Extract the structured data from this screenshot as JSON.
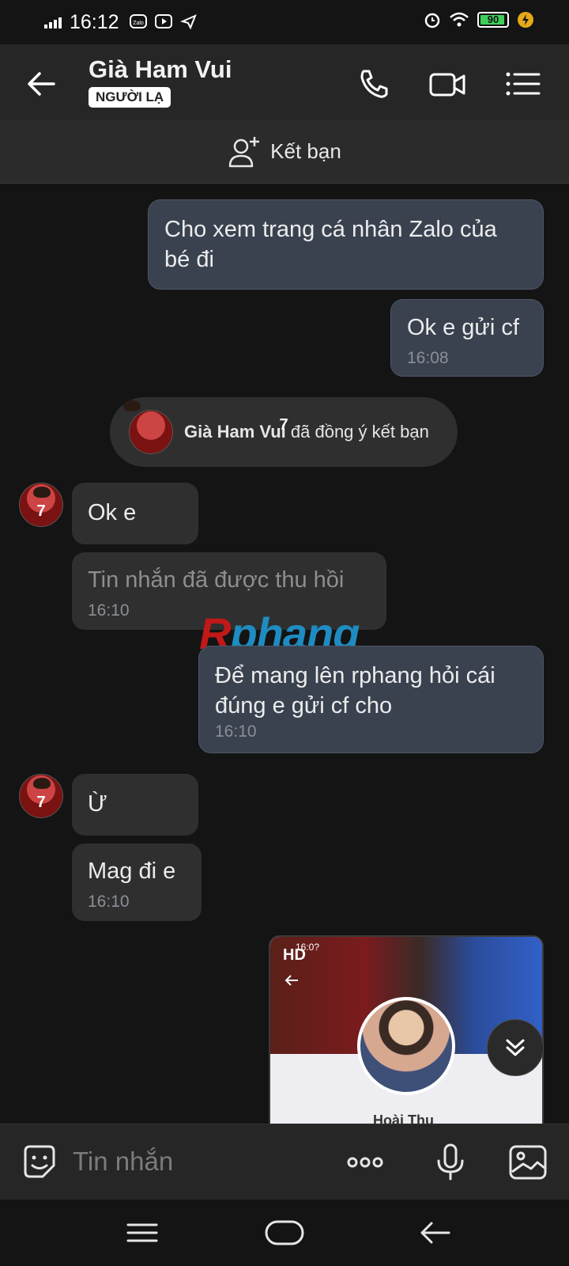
{
  "status_bar": {
    "time": "16:12",
    "battery": "90",
    "app_icons": [
      "zalo-icon",
      "youtube-icon",
      "telegram-icon"
    ],
    "right_icons": [
      "alarm-icon",
      "wifi-icon",
      "battery-icon",
      "charging-icon"
    ]
  },
  "header": {
    "name": "Già Ham Vui",
    "badge": "NGƯỜI LẠ"
  },
  "add_friend": {
    "label": "Kết bạn"
  },
  "messages": {
    "m1": {
      "text": "Cho xem trang cá nhân Zalo của bé đi"
    },
    "m2": {
      "text": "Ok e gửi cf",
      "time": "16:08"
    },
    "system": {
      "name": "Già Ham Vui",
      "text": " đã đồng ý kết bạn"
    },
    "m3": {
      "text": "Ok e"
    },
    "m4": {
      "text": "Tin nhắn đã được thu hồi",
      "time": "16:10"
    },
    "m5": {
      "text": "Để mang lên rphang hỏi cái đúng e gửi cf cho",
      "time": "16:10"
    },
    "m6": {
      "text": "Ừ"
    },
    "m7": {
      "text": "Mag đi e",
      "time": "16:10"
    },
    "image": {
      "badge": "HD",
      "time": "16:0?",
      "profile_name": "Hoài Thu"
    }
  },
  "avatar_number": "7",
  "watermark": {
    "first": "R",
    "rest": "phang"
  },
  "composer": {
    "placeholder": "Tin nhắn"
  },
  "colors": {
    "background": "#141414",
    "header": "#262626",
    "outgoing_bubble": "#3a4250",
    "incoming_bubble": "#2f2f2f",
    "watermark_red": "#c21818",
    "watermark_blue": "#1e8cc2"
  }
}
